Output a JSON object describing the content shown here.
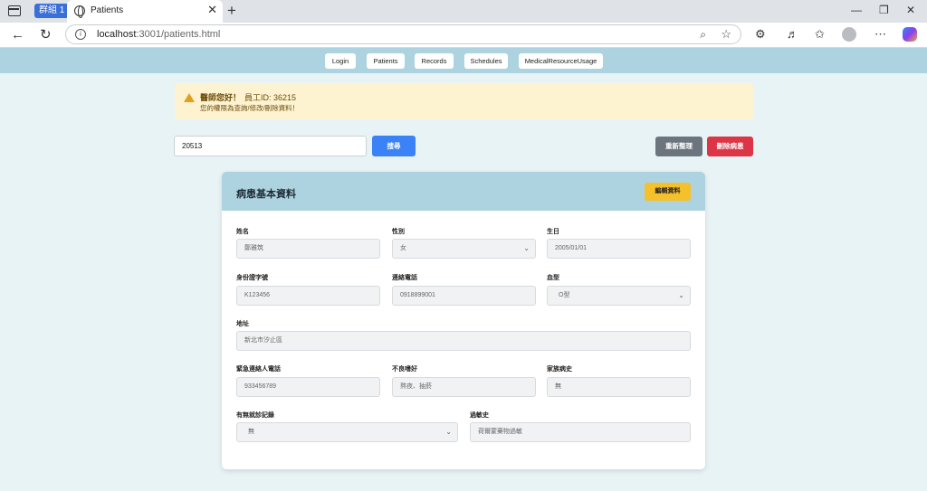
{
  "browser": {
    "group_label": "群組 1",
    "tab_title": "Patients",
    "url_host": "localhost",
    "url_rest": ":3001/patients.html"
  },
  "nav": {
    "items": [
      "Login",
      "Patients",
      "Records",
      "Schedules",
      "MedicalResourceUsage"
    ]
  },
  "alert": {
    "greeting": "醫師您好！",
    "staff_id": "員工ID: 36215",
    "note": "您的權限為查詢/修改/刪除資料！"
  },
  "search": {
    "value": "20513",
    "search_label": "搜尋",
    "reset_label": "重新整理",
    "delete_label": "刪除病患"
  },
  "card": {
    "title": "病患基本資料",
    "edit_label": "編輯資料",
    "fields": {
      "name": {
        "label": "姓名",
        "value": "鄭雅筑"
      },
      "gender": {
        "label": "性別",
        "value": "女"
      },
      "birthday": {
        "label": "生日",
        "value": "2005/01/01"
      },
      "id_number": {
        "label": "身份證字號",
        "value": "K123456"
      },
      "phone": {
        "label": "連絡電話",
        "value": "0918899001"
      },
      "blood_type": {
        "label": "血型",
        "value": "O型"
      },
      "address": {
        "label": "地址",
        "value": "新北市汐止區"
      },
      "emergency_phone": {
        "label": "緊急連絡人電話",
        "value": "933456789"
      },
      "bad_habits": {
        "label": "不良嗜好",
        "value": "熬夜、抽菸"
      },
      "family_history": {
        "label": "家族病史",
        "value": "無"
      },
      "visit_record": {
        "label": "有無就診記錄",
        "value": "無"
      },
      "allergy": {
        "label": "過敏史",
        "value": "荷爾蒙藥物過敏"
      }
    }
  },
  "colors": {
    "accent_blue": "#3b82f6",
    "reset_gray": "#6c757d",
    "delete_red": "#dc3545",
    "edit_yellow": "#f4c02c",
    "header_bg": "#add3e0"
  }
}
